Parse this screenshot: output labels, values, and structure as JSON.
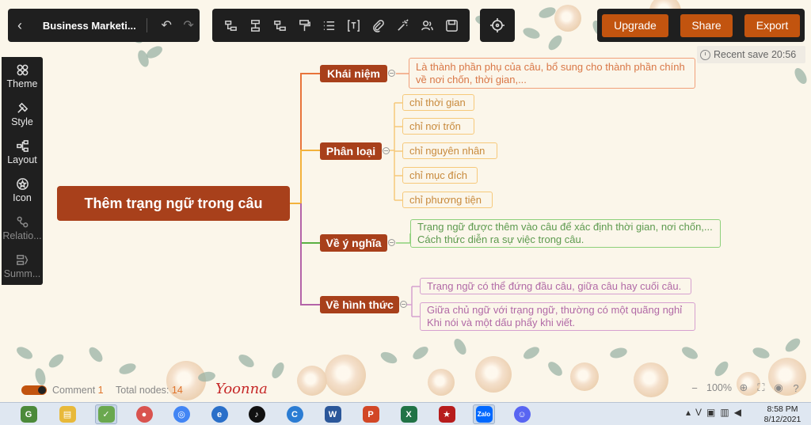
{
  "header": {
    "doc_title": "Business Marketi...",
    "undo_icon": "undo-icon",
    "redo_icon": "redo-icon"
  },
  "toolbar": {
    "icons": [
      "insert-topic-icon",
      "insert-subtopic-icon",
      "insert-parent-icon",
      "format-painter-icon",
      "list-icon",
      "text-box-icon",
      "attachment-icon",
      "ai-magic-icon",
      "people-icon",
      "save-icon"
    ],
    "locate_icon": "locate-icon"
  },
  "actions": {
    "upgrade_label": "Upgrade",
    "share_label": "Share",
    "export_label": "Export"
  },
  "save_status": {
    "text": "Recent save 20:56"
  },
  "sidebar": {
    "items": [
      {
        "label": "Theme",
        "icon": "theme-icon"
      },
      {
        "label": "Style",
        "icon": "style-icon"
      },
      {
        "label": "Layout",
        "icon": "layout-icon"
      },
      {
        "label": "Icon",
        "icon": "icon-icon"
      },
      {
        "label": "Relatio...",
        "icon": "relationship-icon"
      },
      {
        "label": "Summ...",
        "icon": "summary-icon"
      }
    ]
  },
  "mindmap": {
    "root": "Thêm trạng ngữ trong câu",
    "branches": [
      {
        "label": "Khái niệm",
        "color": "#e8743b",
        "children": [
          "Là thành phần phụ của câu, bổ sung cho thành phần chính",
          "về nơi chốn, thời gian,..."
        ]
      },
      {
        "label": "Phân loại",
        "color": "#f3b23c",
        "children": [
          "chỉ thời gian",
          "chỉ nơi trốn",
          "chỉ nguyên nhân",
          "chỉ mục đích",
          "chỉ phương tiện"
        ]
      },
      {
        "label": "Về ý nghĩa",
        "color": "#5ab043",
        "children": [
          "Trạng ngữ được thêm vào câu để xác định thời gian, nơi chốn,...",
          "Cách thức diễn ra sự việc trong câu."
        ]
      },
      {
        "label": "Về hình thức",
        "color": "#b464a8",
        "children": [
          "Trạng ngữ có thể đứng đầu câu, giữa câu hay cuối câu.",
          "Giữa chủ ngữ với trạng ngữ, thường có một quãng nghỉ",
          "Khi nói và một dấu phẩy khi viết."
        ]
      }
    ]
  },
  "status": {
    "comment_label": "Comment",
    "comment_count": "1",
    "nodes_label": "Total nodes:",
    "nodes_count": "14",
    "signature": "Yoonna",
    "zoom": "100%"
  },
  "taskbar": {
    "apps": [
      {
        "icon": "game-icon",
        "color": "#4c8a3a"
      },
      {
        "icon": "file-explorer-icon",
        "color": "#e8b93a"
      },
      {
        "icon": "greenshot-icon",
        "color": "#6aa84f"
      },
      {
        "icon": "photos-icon",
        "color": "#d9534f"
      },
      {
        "icon": "chrome-icon",
        "color": "#4285f4"
      },
      {
        "icon": "browser-icon",
        "color": "#2a6fc9"
      },
      {
        "icon": "tiktok-icon",
        "color": "#111111"
      },
      {
        "icon": "cortana-icon",
        "color": "#2b7cd3"
      },
      {
        "icon": "word-icon",
        "color": "#2b579a"
      },
      {
        "icon": "powerpoint-icon",
        "color": "#d24726"
      },
      {
        "icon": "excel-icon",
        "color": "#217346"
      },
      {
        "icon": "game2-icon",
        "color": "#b71c1c"
      },
      {
        "icon": "zalo-icon",
        "color": "#0068ff"
      },
      {
        "icon": "discord-icon",
        "color": "#5865f2"
      }
    ],
    "tray_v": "V",
    "time": "8:58 PM",
    "date": "8/12/2021"
  }
}
